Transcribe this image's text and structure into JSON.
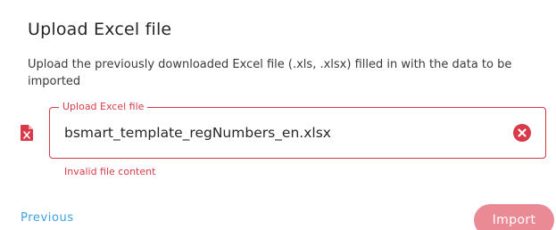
{
  "dialog": {
    "title": "Upload Excel file",
    "description": "Upload the previously downloaded Excel file (.xls, .xlsx) filled in with the data to be imported"
  },
  "file_field": {
    "label": "Upload Excel file",
    "value": "bsmart_template_regNumbers_en.xlsx",
    "error": "Invalid file content",
    "icon": "excel-file-icon",
    "clear_icon": "clear-circle-icon"
  },
  "actions": {
    "previous_label": "Previous",
    "import_label": "Import"
  },
  "colors": {
    "error": "#d93a4a",
    "link": "#3ba3de",
    "import_button": "#e98a95"
  }
}
